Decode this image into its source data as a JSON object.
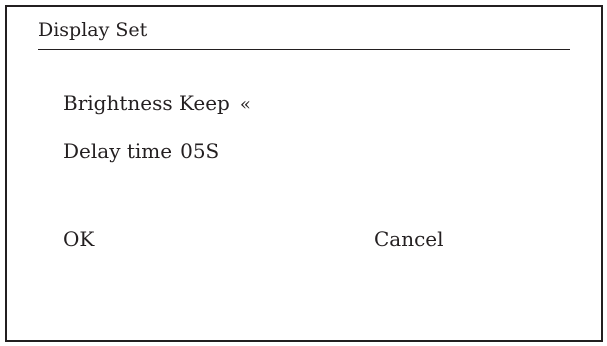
{
  "dialog": {
    "title": "Display Set"
  },
  "settings": [
    {
      "label": "Brightness Keep",
      "selection_marker": "«"
    },
    {
      "label": "Delay time",
      "value": "05S"
    }
  ],
  "buttons": {
    "ok_label": "OK",
    "cancel_label": "Cancel"
  },
  "colors": {
    "text": "#231f20",
    "border": "#231f20",
    "background": "#ffffff"
  }
}
